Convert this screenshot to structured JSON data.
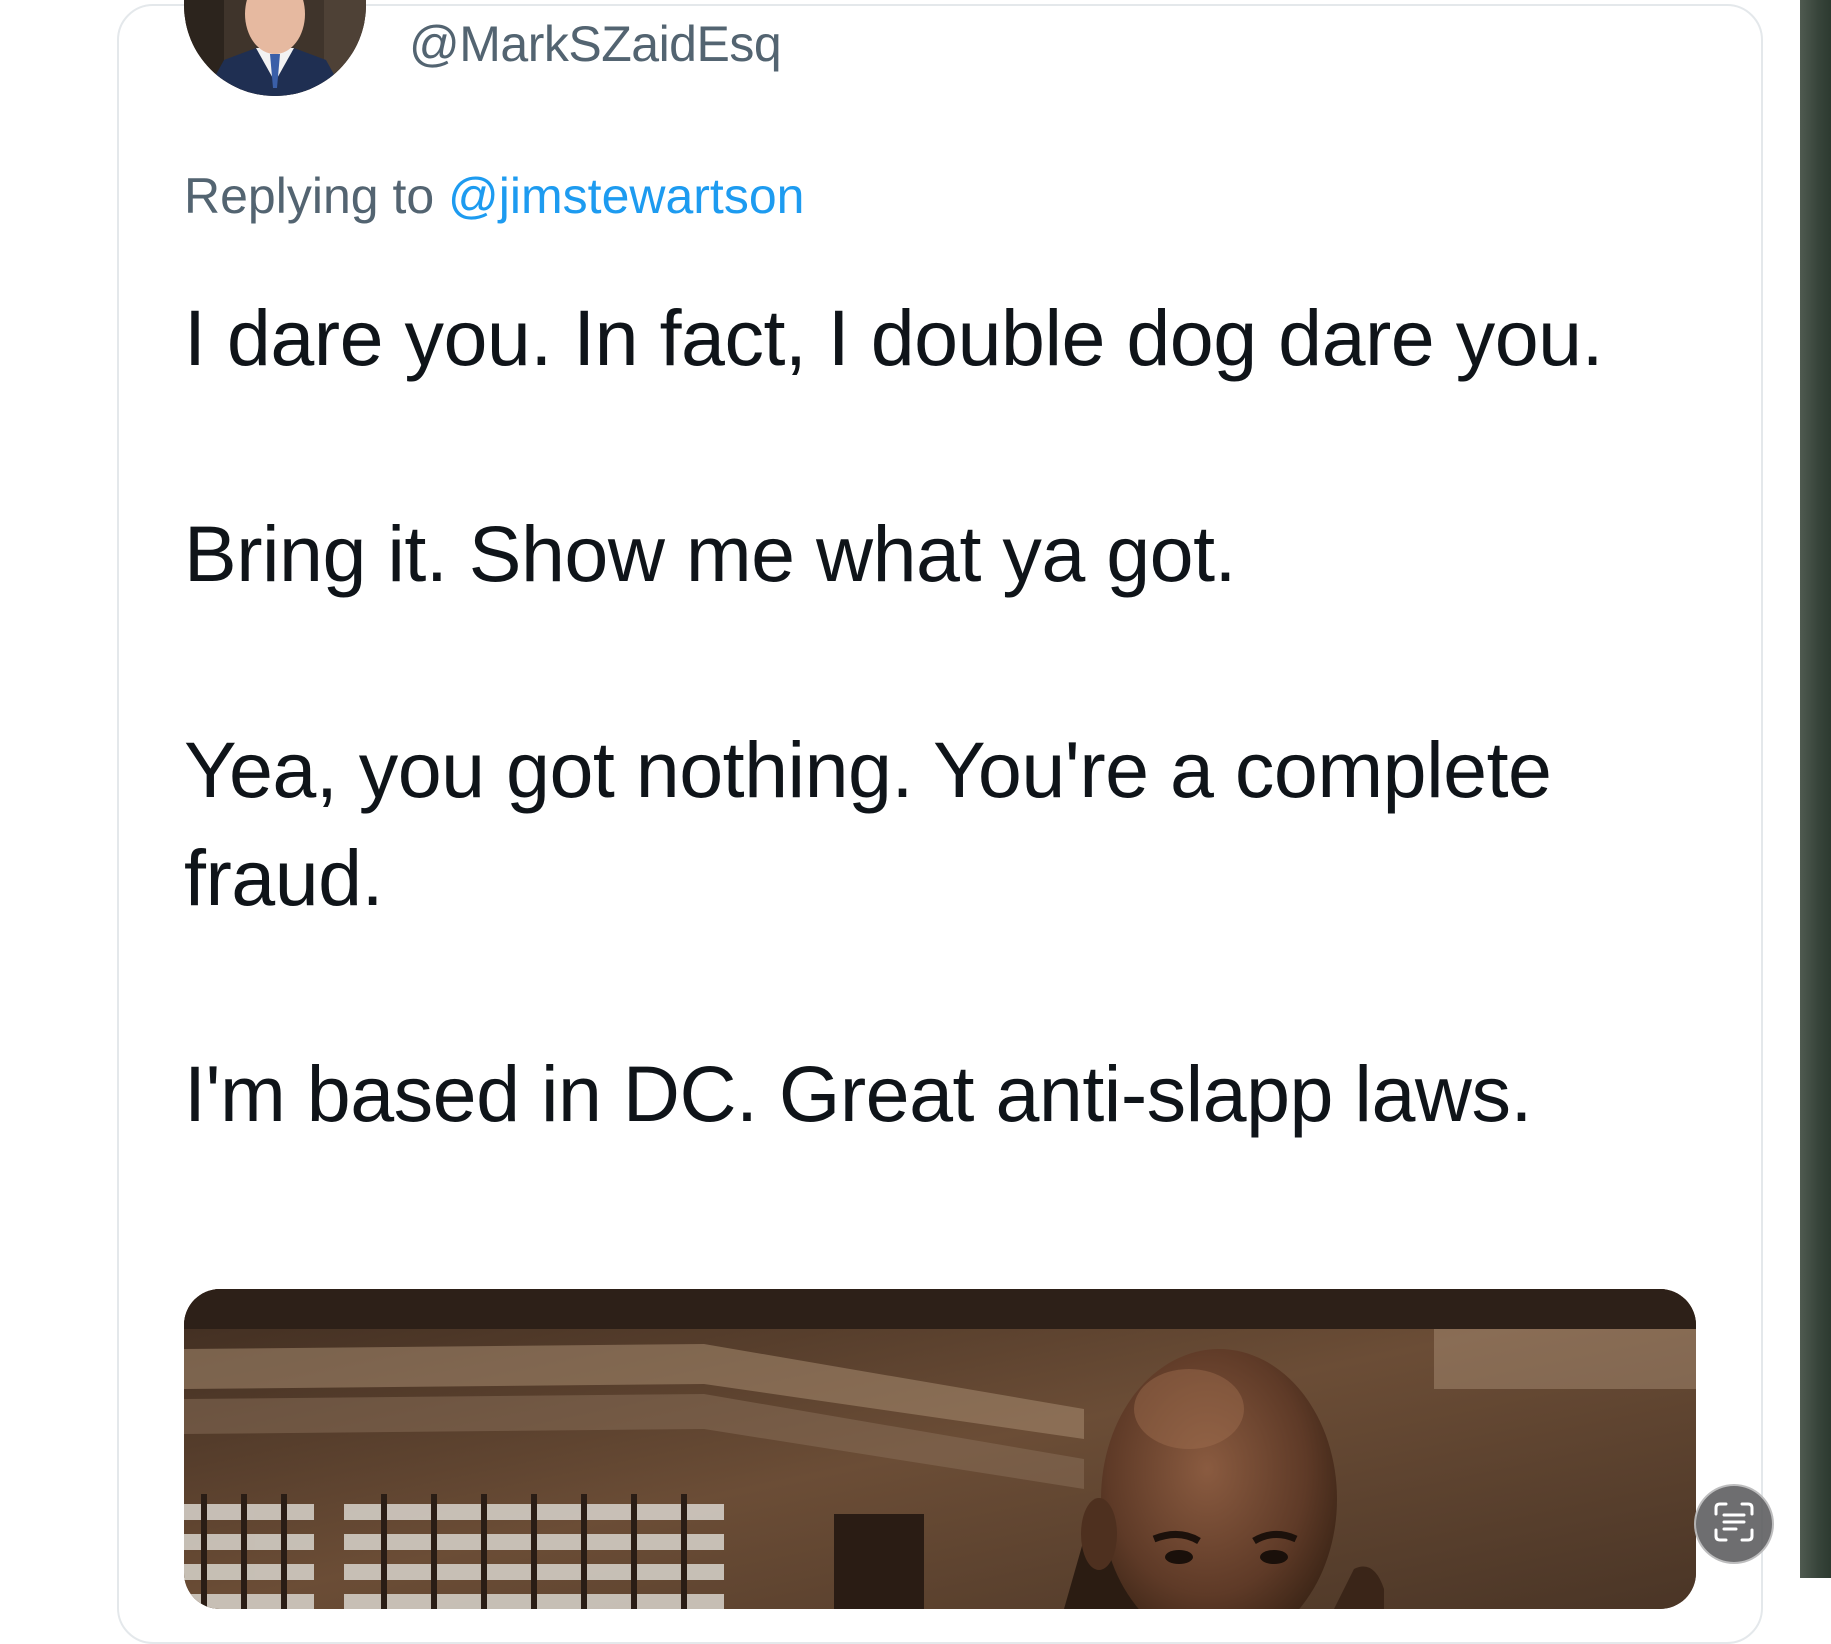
{
  "tweet": {
    "author_handle": "@MarkSZaidEsq",
    "replying_prefix": "Replying to ",
    "replying_handle": "@jimstewartson",
    "paragraphs": [
      "I dare you. In fact, I double dog dare you.",
      "Bring it. Show me what ya got.",
      "Yea, you got nothing. You're a complete fraud.",
      "I'm based in DC. Great anti-slapp laws."
    ]
  },
  "icons": {
    "scan_button": "text-scan-icon"
  },
  "colors": {
    "handle_gray": "#536471",
    "link_blue": "#1d9bf0",
    "text_dark": "#0f1419",
    "card_border": "#e4e8eb"
  }
}
